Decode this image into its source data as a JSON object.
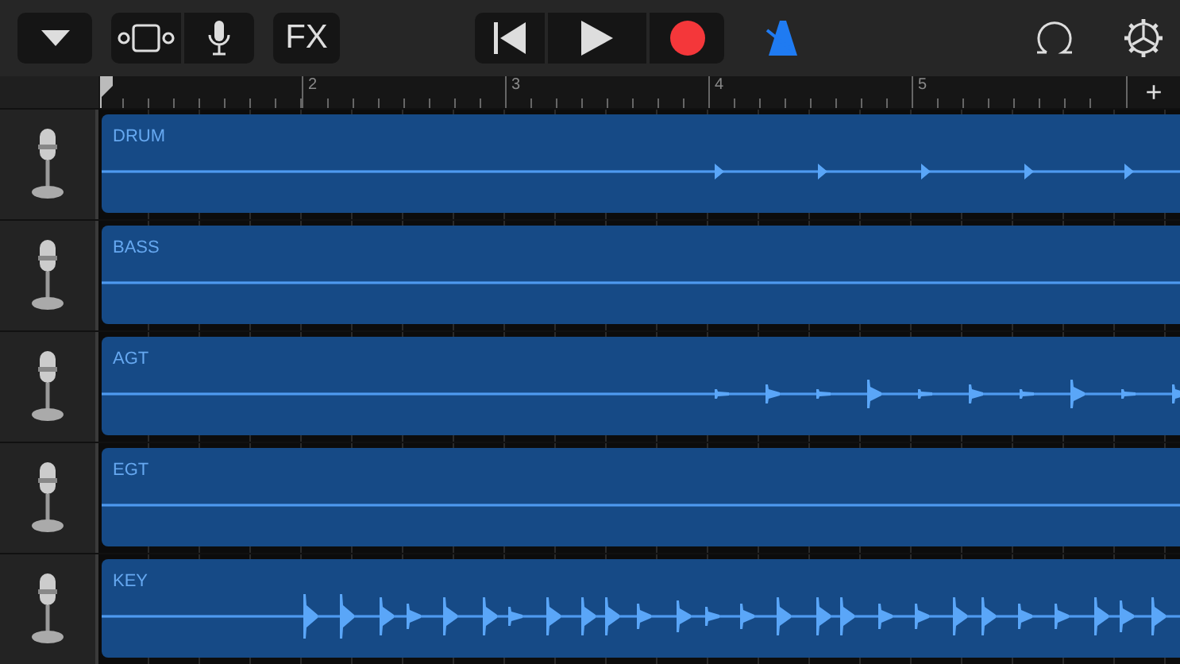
{
  "toolbar": {
    "fx_label": "FX",
    "metronome": {
      "on": true
    }
  },
  "ruler": {
    "bars": [
      "2",
      "3",
      "4",
      "5"
    ],
    "add_label": "+"
  },
  "tracks": [
    {
      "name": "DRUM"
    },
    {
      "name": "BASS"
    },
    {
      "name": "AGT"
    },
    {
      "name": "EGT"
    },
    {
      "name": "KEY"
    }
  ]
}
